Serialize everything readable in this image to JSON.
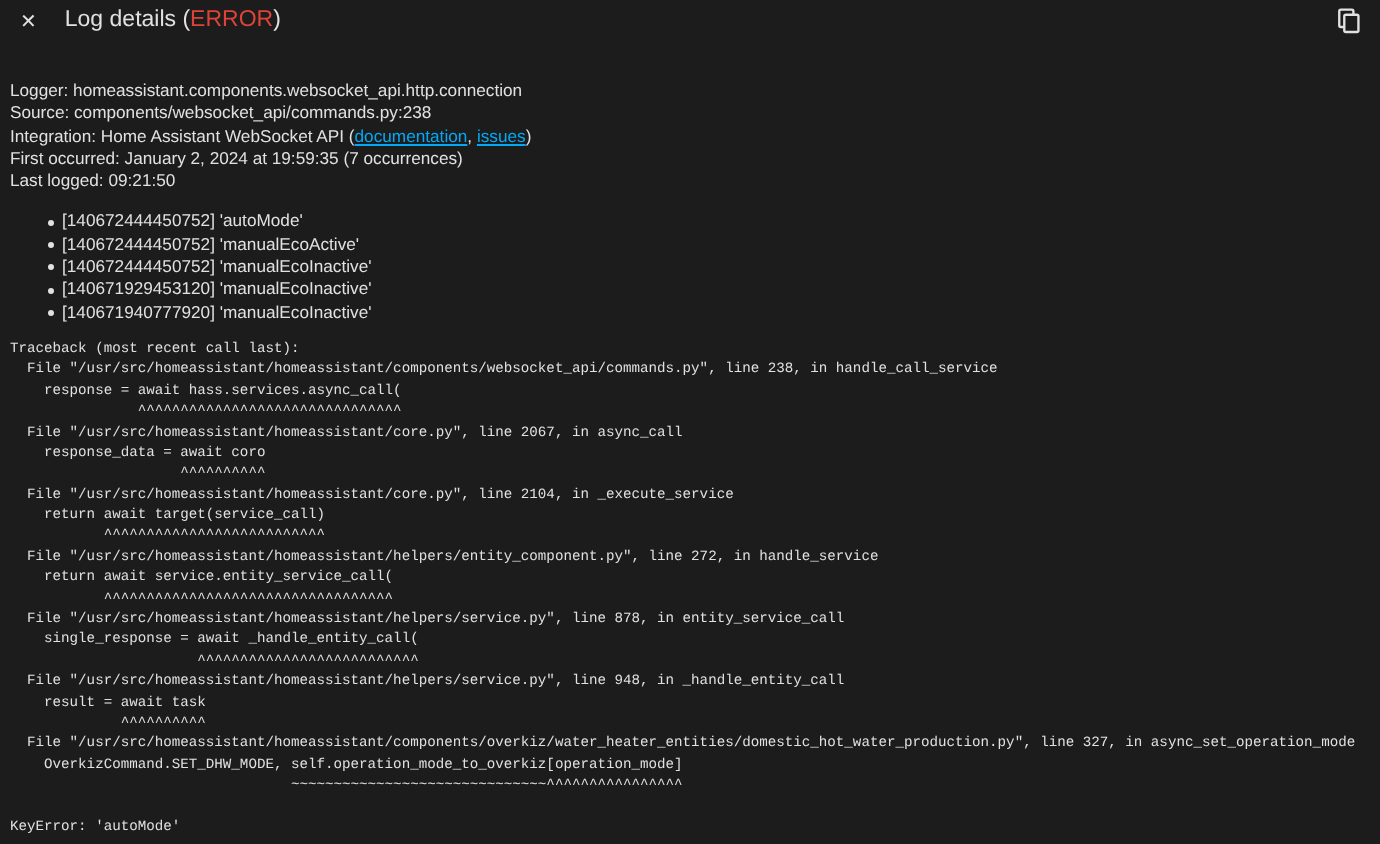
{
  "header": {
    "close": "✕",
    "title": "Log details (",
    "level": "ERROR",
    "title_end": ")"
  },
  "info": [
    {
      "parts": [
        {
          "text": "Logger: homeassistant.components.websocket_api.http.connection"
        }
      ]
    },
    {
      "parts": [
        {
          "text": "Source: components/websocket_api/commands.py:238"
        }
      ]
    },
    {
      "parts": [
        {
          "text": "Integration: Home Assistant WebSocket API ("
        },
        {
          "link": "documentation",
          "after": ", "
        },
        {
          "link": "issues",
          "after": ")"
        }
      ]
    },
    {
      "parts": [
        {
          "text": "First occurred: January 2, 2024 at 19:59:35 (7 occurrences)"
        }
      ]
    },
    {
      "parts": [
        {
          "text": "Last logged: 09:21:50"
        }
      ]
    }
  ],
  "messages": [
    "[140672444450752] 'autoMode'",
    "[140672444450752] 'manualEcoActive'",
    "[140672444450752] 'manualEcoInactive'",
    "[140671929453120] 'manualEcoInactive'",
    "[140671940777920] 'manualEcoInactive'"
  ],
  "traceback": [
    "Traceback (most recent call last):",
    "  File \"/usr/src/homeassistant/homeassistant/components/websocket_api/commands.py\", line 238, in handle_call_service",
    "    response = await hass.services.async_call(",
    "               ^^^^^^^^^^^^^^^^^^^^^^^^^^^^^^^",
    "  File \"/usr/src/homeassistant/homeassistant/core.py\", line 2067, in async_call",
    "    response_data = await coro",
    "                    ^^^^^^^^^^",
    "  File \"/usr/src/homeassistant/homeassistant/core.py\", line 2104, in _execute_service",
    "    return await target(service_call)",
    "           ^^^^^^^^^^^^^^^^^^^^^^^^^^",
    "  File \"/usr/src/homeassistant/homeassistant/helpers/entity_component.py\", line 272, in handle_service",
    "    return await service.entity_service_call(",
    "           ^^^^^^^^^^^^^^^^^^^^^^^^^^^^^^^^^^",
    "  File \"/usr/src/homeassistant/homeassistant/helpers/service.py\", line 878, in entity_service_call",
    "    single_response = await _handle_entity_call(",
    "                      ^^^^^^^^^^^^^^^^^^^^^^^^^^",
    "  File \"/usr/src/homeassistant/homeassistant/helpers/service.py\", line 948, in _handle_entity_call",
    "    result = await task",
    "             ^^^^^^^^^^",
    "  File \"/usr/src/homeassistant/homeassistant/components/overkiz/water_heater_entities/domestic_hot_water_production.py\", line 327, in async_set_operation_mode",
    "    OverkizCommand.SET_DHW_MODE, self.operation_mode_to_overkiz[operation_mode]",
    "                                 ~~~~~~~~~~~~~~~~~~~~~~~~~~~~~~^^^^^^^^^^^^^^^^"
  ],
  "error": "KeyError: 'autoMode'"
}
